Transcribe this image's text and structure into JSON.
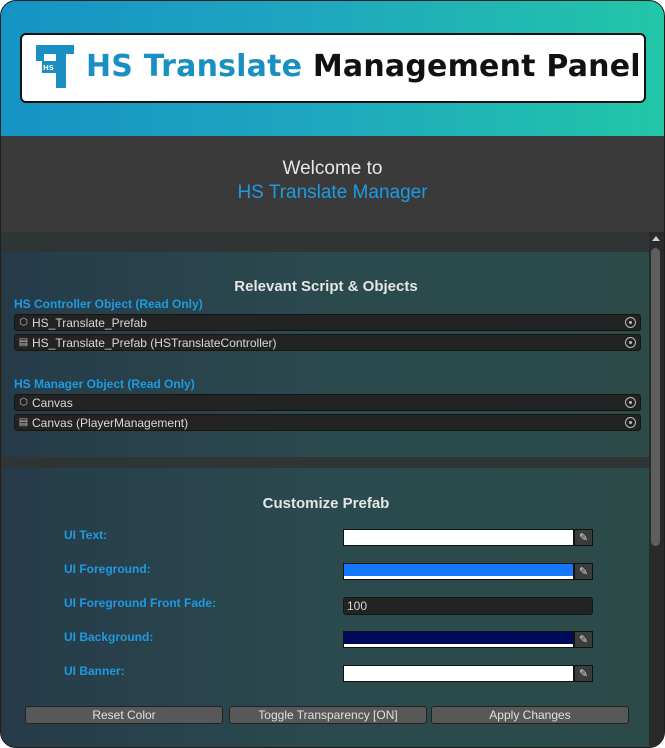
{
  "banner": {
    "title_part1": "HS Translate",
    "title_part2": "Management Panel",
    "logo_text": "HS"
  },
  "welcome": {
    "line1": "Welcome to",
    "line2": "HS Translate Manager"
  },
  "relevant": {
    "title": "Relevant Script & Objects",
    "controller": {
      "label": "HS Controller Object (Read Only)",
      "fields": [
        {
          "icon": "gameobject-icon",
          "text": "HS_Translate_Prefab"
        },
        {
          "icon": "script-icon",
          "text": "HS_Translate_Prefab (HSTranslateController)"
        }
      ]
    },
    "manager": {
      "label": "HS Manager Object (Read Only)",
      "fields": [
        {
          "icon": "gameobject-icon",
          "text": "Canvas"
        },
        {
          "icon": "script-icon",
          "text": "Canvas (PlayerManagement)"
        }
      ]
    }
  },
  "customize": {
    "title": "Customize Prefab",
    "ui_text": {
      "label": "UI Text:",
      "color": "#ffffff"
    },
    "ui_foreground": {
      "label": "UI Foreground:",
      "color": "#1478ff"
    },
    "ui_fade": {
      "label": "UI Foreground Front Fade:",
      "value": "100"
    },
    "ui_background": {
      "label": "UI Background:",
      "color": "#000a5a"
    },
    "ui_banner": {
      "label": "UI Banner:",
      "color": "#ffffff"
    },
    "buttons": {
      "reset": "Reset Color",
      "toggle": "Toggle Transparency [ON]",
      "apply": "Apply Changes"
    }
  },
  "colors": {
    "accent": "#1e9be0",
    "banner_gradient_start": "#1593c4",
    "banner_gradient_end": "#22c6a8"
  }
}
